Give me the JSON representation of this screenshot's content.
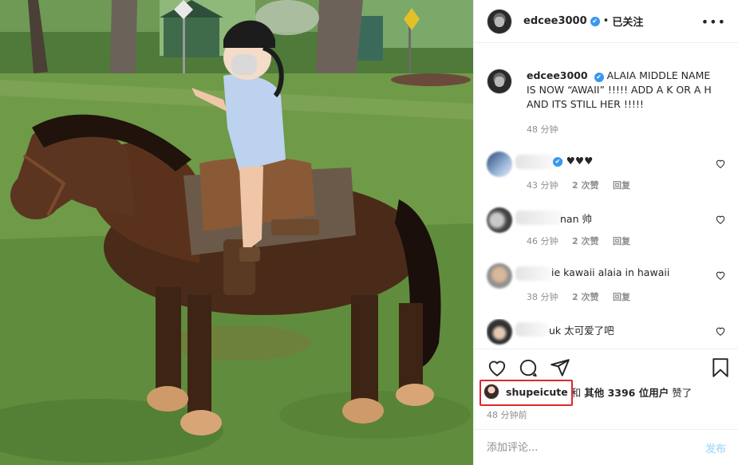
{
  "header": {
    "username": "edcee3000",
    "verified": "✔",
    "separator": "•",
    "follow_state": "已关注",
    "more": "•••"
  },
  "caption": {
    "username": "edcee3000",
    "text": " ALAIA MIDDLE NAME IS NOW “AWAII” !!!!! ADD A K OR A H AND ITS STILL HER !!!!!",
    "time": "48 分钟"
  },
  "comments": [
    {
      "text": "e  ♥♥♥",
      "verified": true,
      "time": "43 分钟",
      "likes": "2 次赞",
      "reply": "回复"
    },
    {
      "text": "nan 帅",
      "verified": false,
      "time": "46 分钟",
      "likes": "2 次赞",
      "reply": "回复"
    },
    {
      "text": "ie kawaii alaia in hawaii",
      "verified": false,
      "time": "38 分钟",
      "likes": "2 次赞",
      "reply": "回复"
    },
    {
      "text": "uk 太可爱了吧",
      "verified": false,
      "time": "",
      "likes": "",
      "reply": ""
    }
  ],
  "likes": {
    "user": "shupeicute",
    "and": "和",
    "others": "其他 3396 位用户",
    "suffix": "赞了"
  },
  "post_time": "48 分钟前",
  "comment_box": {
    "placeholder": "添加评论...",
    "post_label": "发布"
  },
  "colors": {
    "link_blue": "#3897f0",
    "post_disabled": "#b2dffc",
    "highlight_red": "#e1262a",
    "meta_grey": "#8e8e8e"
  }
}
